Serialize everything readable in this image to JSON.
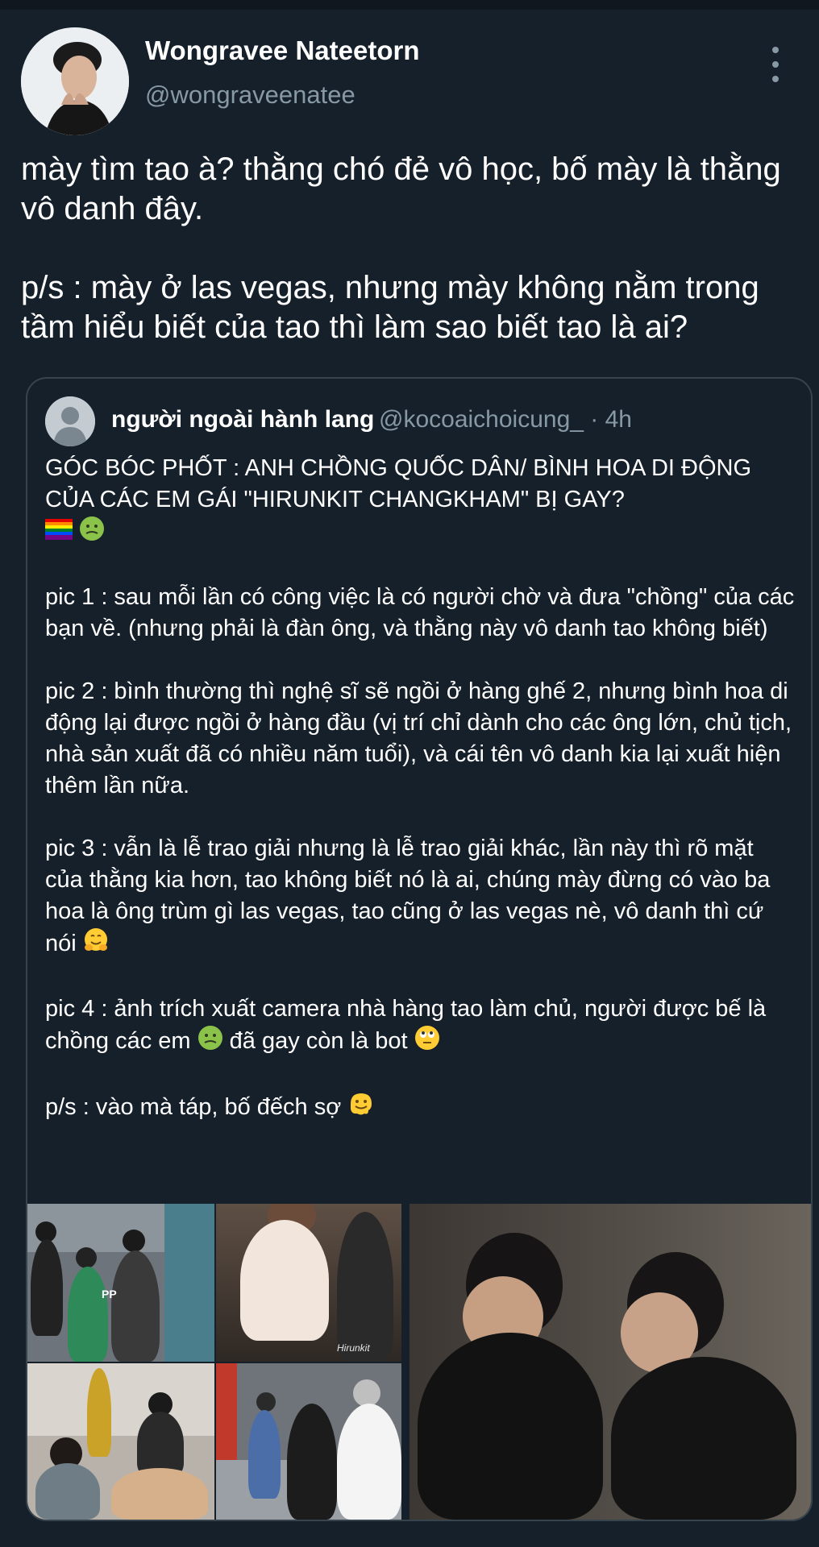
{
  "author": {
    "name": "Wongravee Nateetorn",
    "handle": "@wongraveenatee",
    "avatar": "profile-photo",
    "more_icon": "more-vertical-icon"
  },
  "tweet": {
    "lines": [
      "mày tìm tao à? thằng chó đẻ vô học, bố mày là thằng vô danh đây.",
      "p/s : mày ở las vegas, nhưng mày không nằm trong tầm hiểu biết của tao thì làm sao biết tao là ai?"
    ]
  },
  "quoted": {
    "name": "người ngoài hành lang",
    "handle": "@kocoaichoicung_ · 4h",
    "avatar": "default-avatar-icon",
    "headline": "GÓC BÓC PHỐT : ANH CHỒNG QUỐC DÂN/ BÌNH HOA DI ĐỘNG CỦA CÁC EM GÁI \"HIRUNKIT CHANGKHAM\" BỊ GAY?",
    "headline_emojis": [
      "rainbow-flag-icon",
      "nauseated-face-icon"
    ],
    "pic1": "pic 1 :  sau mỗi lần có công việc là có người chờ và đưa \"chồng\" của các bạn về. (nhưng phải là đàn ông, và thằng này vô danh tao không biết)",
    "pic2": "pic 2 : bình thường thì nghệ sĩ sẽ ngồi ở hàng ghế 2, nhưng bình hoa di động lại được ngồi ở hàng đầu (vị trí chỉ dành cho các ông lớn, chủ tịch, nhà sản xuất đã có nhiều năm tuổi),  và cái tên vô danh kia lại xuất hiện thêm lần nữa.",
    "pic3": "pic 3 : vẫn là lễ trao giải nhưng là lễ trao giải khác, lần này thì rõ mặt của thằng kia hơn, tao không biết nó là ai, chúng mày đừng có vào ba hoa là ông trùm gì las vegas, tao cũng ở las vegas nè, vô danh thì cứ nói",
    "pic3_emoji": "hugging-face-icon",
    "pic4_a": "pic 4 :  ảnh trích xuất camera nhà hàng tao làm chủ, người được bế là chồng các em",
    "pic4_emoji1": "nauseated-face-icon",
    "pic4_b": "đã gay còn là bot",
    "pic4_emoji2": "eye-roll-face-icon",
    "ps": "p/s : vào mà táp, bố đếch sợ",
    "ps_emoji": "melting-face-icon"
  },
  "media": {
    "tiles": [
      "photo-airport",
      "photo-walking-back",
      "photo-award-ceremony",
      "photo-camera-still",
      "photo-seated-profiles"
    ],
    "watermark1": "PP",
    "watermark2": "Hirunkit"
  }
}
